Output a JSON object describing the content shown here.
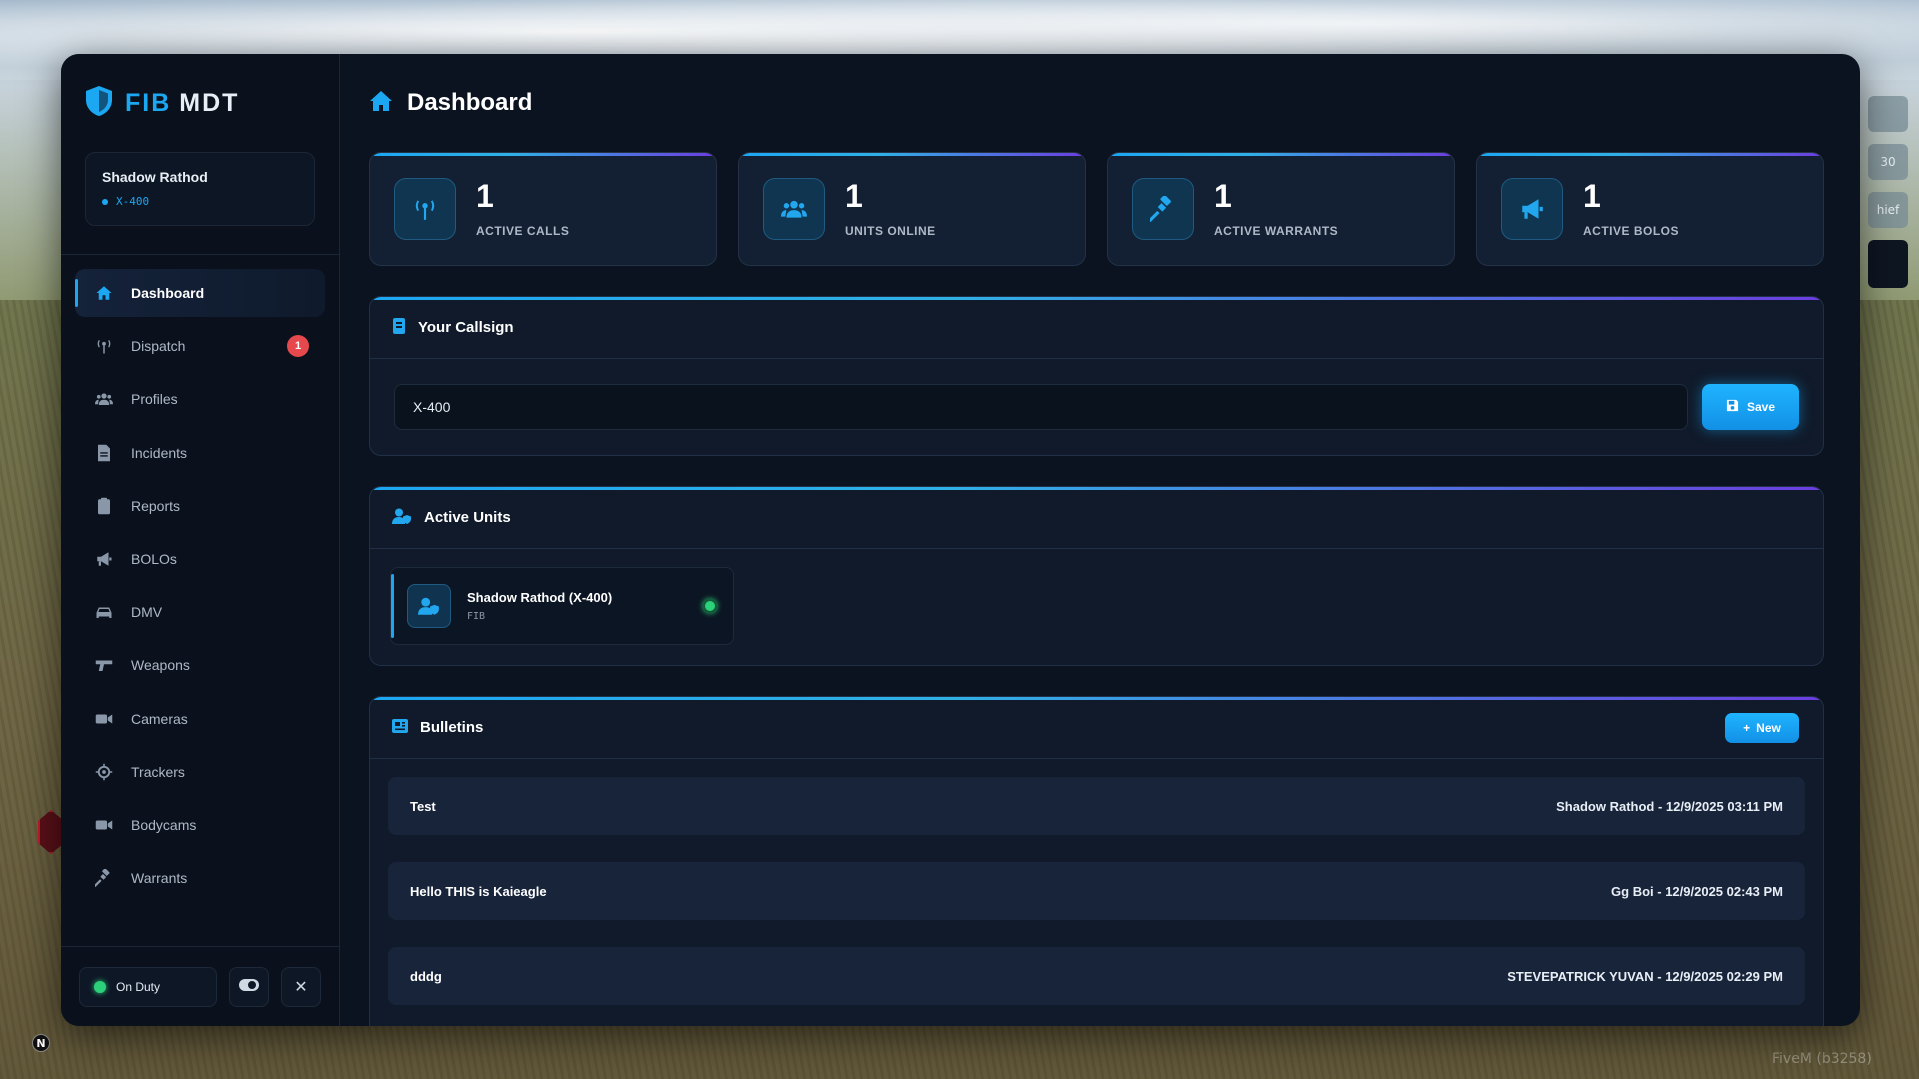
{
  "brand": {
    "fib": "FIB",
    "mdt": "MDT"
  },
  "user": {
    "name": "Shadow Rathod",
    "callsign": "X-400"
  },
  "nav": [
    {
      "label": "Dashboard",
      "icon": "home-icon",
      "active": true
    },
    {
      "label": "Dispatch",
      "icon": "antenna-icon",
      "badge": "1"
    },
    {
      "label": "Profiles",
      "icon": "users-icon"
    },
    {
      "label": "Incidents",
      "icon": "file-icon"
    },
    {
      "label": "Reports",
      "icon": "clipboard-icon"
    },
    {
      "label": "BOLOs",
      "icon": "megaphone-icon"
    },
    {
      "label": "DMV",
      "icon": "car-icon"
    },
    {
      "label": "Weapons",
      "icon": "gun-icon"
    },
    {
      "label": "Cameras",
      "icon": "video-icon"
    },
    {
      "label": "Trackers",
      "icon": "crosshair-icon"
    },
    {
      "label": "Bodycams",
      "icon": "video-icon"
    },
    {
      "label": "Warrants",
      "icon": "gavel-icon"
    }
  ],
  "footer": {
    "duty_label": "On Duty"
  },
  "page": {
    "title": "Dashboard"
  },
  "stats": [
    {
      "value": "1",
      "label": "ACTIVE CALLS",
      "icon": "antenna-icon"
    },
    {
      "value": "1",
      "label": "UNITS ONLINE",
      "icon": "users-icon"
    },
    {
      "value": "1",
      "label": "ACTIVE WARRANTS",
      "icon": "gavel-icon"
    },
    {
      "value": "1",
      "label": "ACTIVE BOLOS",
      "icon": "megaphone-icon"
    }
  ],
  "callsign": {
    "title": "Your Callsign",
    "value": "X-400",
    "save_label": "Save"
  },
  "units": {
    "title": "Active Units",
    "items": [
      {
        "name": "Shadow Rathod (X-400)",
        "agency": "FIB",
        "status": "online"
      }
    ]
  },
  "bulletins": {
    "title": "Bulletins",
    "new_label": "New",
    "items": [
      {
        "title": "Test",
        "meta": "Shadow Rathod - 12/9/2025 03:11 PM"
      },
      {
        "title": "Hello THIS is Kaieagle",
        "meta": "Gg Boi - 12/9/2025 02:43 PM"
      },
      {
        "title": "dddg",
        "meta": "STEVEPATRICK YUVAN - 12/9/2025 02:29 PM"
      }
    ]
  },
  "overlay": {
    "side_labels": [
      "",
      "30",
      "hief",
      ""
    ],
    "watermark": "FiveM (b3258)",
    "n_badge": "N"
  },
  "colors": {
    "accent": "#1ba7f2",
    "online": "#2bd27a",
    "badge": "#e5484d",
    "background": "#0b1320"
  }
}
